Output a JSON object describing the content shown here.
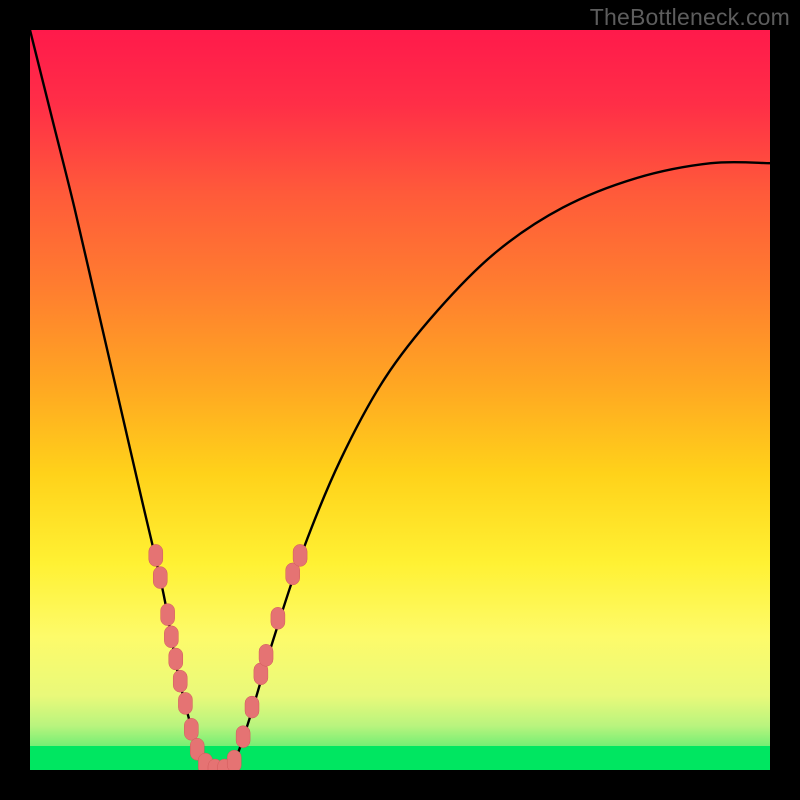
{
  "watermark": "TheBottleneck.com",
  "colors": {
    "frame": "#000000",
    "curve": "#000000",
    "marker_fill": "#e57373",
    "marker_stroke": "#d15b5b",
    "bottom_strip": "#00e661",
    "gradient_stops": [
      {
        "offset": 0.0,
        "color": "#ff1a4b"
      },
      {
        "offset": 0.1,
        "color": "#ff2e47"
      },
      {
        "offset": 0.22,
        "color": "#ff5a3a"
      },
      {
        "offset": 0.35,
        "color": "#ff7e2f"
      },
      {
        "offset": 0.48,
        "color": "#ffa722"
      },
      {
        "offset": 0.6,
        "color": "#ffd21a"
      },
      {
        "offset": 0.72,
        "color": "#fff133"
      },
      {
        "offset": 0.82,
        "color": "#fdfb6a"
      },
      {
        "offset": 0.9,
        "color": "#e9f97a"
      },
      {
        "offset": 0.94,
        "color": "#b9f47e"
      },
      {
        "offset": 0.97,
        "color": "#6fee73"
      },
      {
        "offset": 1.0,
        "color": "#00e661"
      }
    ]
  },
  "chart_data": {
    "type": "line",
    "title": "",
    "xlabel": "",
    "ylabel": "",
    "xlim": [
      0,
      100
    ],
    "ylim": [
      0,
      100
    ],
    "note": "Axes are unlabeled in the image; x/y are normalized 0-100. y is the curve height (0 at bottom, 100 at top).",
    "series": [
      {
        "name": "bottleneck-curve",
        "x": [
          0,
          3,
          6,
          9,
          12,
          15,
          18,
          20,
          22,
          23,
          24,
          25,
          26,
          27,
          28,
          30,
          33,
          37,
          42,
          48,
          55,
          63,
          72,
          82,
          92,
          100
        ],
        "y": [
          100,
          88,
          76,
          63,
          50,
          37,
          24,
          13,
          5,
          2,
          0,
          0,
          0,
          0,
          2,
          8,
          18,
          30,
          42,
          53,
          62,
          70,
          76,
          80,
          82,
          82
        ]
      }
    ],
    "markers": {
      "name": "highlight-points",
      "note": "pink rounded markers along the lower part of the V",
      "points": [
        {
          "x": 17.0,
          "y": 29.0
        },
        {
          "x": 17.6,
          "y": 26.0
        },
        {
          "x": 18.6,
          "y": 21.0
        },
        {
          "x": 19.1,
          "y": 18.0
        },
        {
          "x": 19.7,
          "y": 15.0
        },
        {
          "x": 20.3,
          "y": 12.0
        },
        {
          "x": 21.0,
          "y": 9.0
        },
        {
          "x": 21.8,
          "y": 5.5
        },
        {
          "x": 22.6,
          "y": 2.8
        },
        {
          "x": 23.7,
          "y": 0.8
        },
        {
          "x": 25.0,
          "y": 0.0
        },
        {
          "x": 26.3,
          "y": 0.0
        },
        {
          "x": 27.6,
          "y": 1.2
        },
        {
          "x": 28.8,
          "y": 4.5
        },
        {
          "x": 30.0,
          "y": 8.5
        },
        {
          "x": 31.2,
          "y": 13.0
        },
        {
          "x": 31.9,
          "y": 15.5
        },
        {
          "x": 33.5,
          "y": 20.5
        },
        {
          "x": 35.5,
          "y": 26.5
        },
        {
          "x": 36.5,
          "y": 29.0
        }
      ]
    }
  }
}
